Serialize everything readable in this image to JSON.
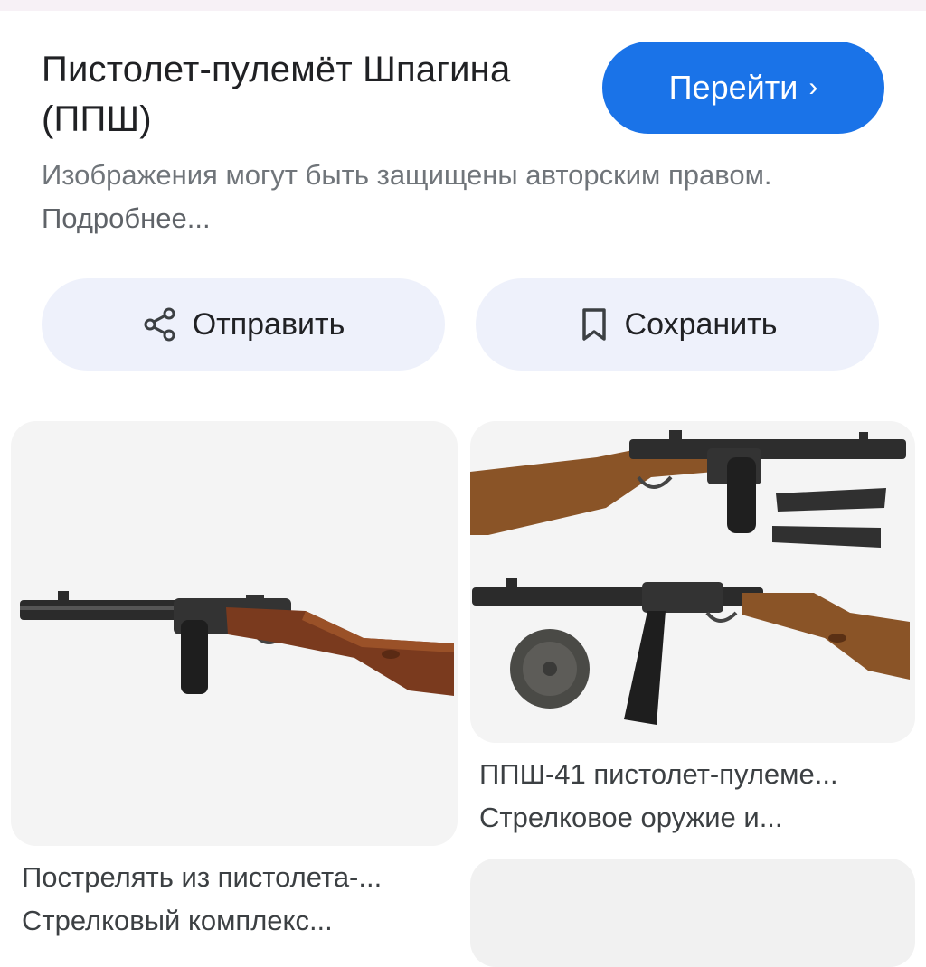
{
  "header": {
    "title": "Пистолет-пулемёт Шпагина (ППШ)",
    "go_label": "Перейти",
    "copyright_text": "Изображения могут быть защищены авторским правом.",
    "more_link": "Подробнее..."
  },
  "actions": {
    "share_label": "Отправить",
    "save_label": "Сохранить"
  },
  "results": [
    {
      "title": "Пострелять из пистолета-...",
      "source": "Стрелковый комплекс..."
    },
    {
      "title": "ППШ-41 пистолет-пулеме...",
      "source": "Стрелковое оружие и..."
    }
  ],
  "colors": {
    "accent": "#1a73e8",
    "pill_bg": "#eef1fb",
    "wood": "#7a3a1e",
    "metal": "#2b2b2b"
  }
}
